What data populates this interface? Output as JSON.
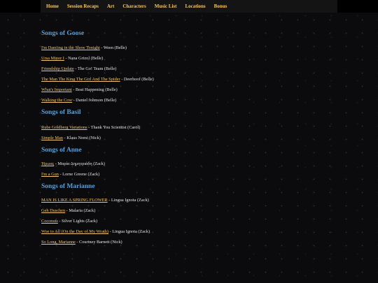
{
  "nav": {
    "items": [
      "Home",
      "Session Recaps",
      "Art",
      "Characters",
      "Music List",
      "Locations",
      "Bonus"
    ]
  },
  "sections": [
    {
      "title": "Songs of Goose",
      "songs": [
        {
          "title": "I'm Dancing in the Show Tonight",
          "detail": " - Ween (Belle)"
        },
        {
          "title": "Ursa Minor I",
          "detail": " - Nana Grizol (Belle)"
        },
        {
          "title": "Friendship Update",
          "detail": " - The Go! Team (Belle)"
        },
        {
          "title": "The Man The King The Girl And The Spider",
          "detail": " - Deerhoof (Belle)"
        },
        {
          "title": "What's Important",
          "detail": " - Beat Happening (Belle)"
        },
        {
          "title": "Walking the Cow",
          "detail": " - Daniel Johnson (Belle)"
        }
      ]
    },
    {
      "title": "Songs of Basil",
      "songs": [
        {
          "title": "Rube Goldberg Variations",
          "detail": " - Thank You Scientist (Carol)"
        },
        {
          "title": "Simple Man",
          "detail": " - Klaus Nomi (Nick)"
        }
      ]
    },
    {
      "title": "Songs of Anne",
      "songs": [
        {
          "title": "Ήρωας",
          "detail": " - Μαρία Δημητριάδη (Zack)"
        },
        {
          "title": "I'm a Gun",
          "detail": " - Lorne Greene (Zack)"
        }
      ]
    },
    {
      "title": "Songs of Marianne",
      "songs": [
        {
          "title": "MAN IS LIKE A SPRING FLOWER",
          "detail": " - Lingua Ignota (Zack)"
        },
        {
          "title": "Geh Duschen",
          "detail": " - Malaria (Zack)"
        },
        {
          "title": "Coconuts",
          "detail": " - Silver Lights (Zack)"
        },
        {
          "title": "Woe to All (On the Day of My Wrath)",
          "detail": " - Lingua Ignota (Zack)"
        },
        {
          "title": "So Long, Marianne",
          "detail": " - Courtney Barnett (Nick)"
        }
      ]
    }
  ]
}
